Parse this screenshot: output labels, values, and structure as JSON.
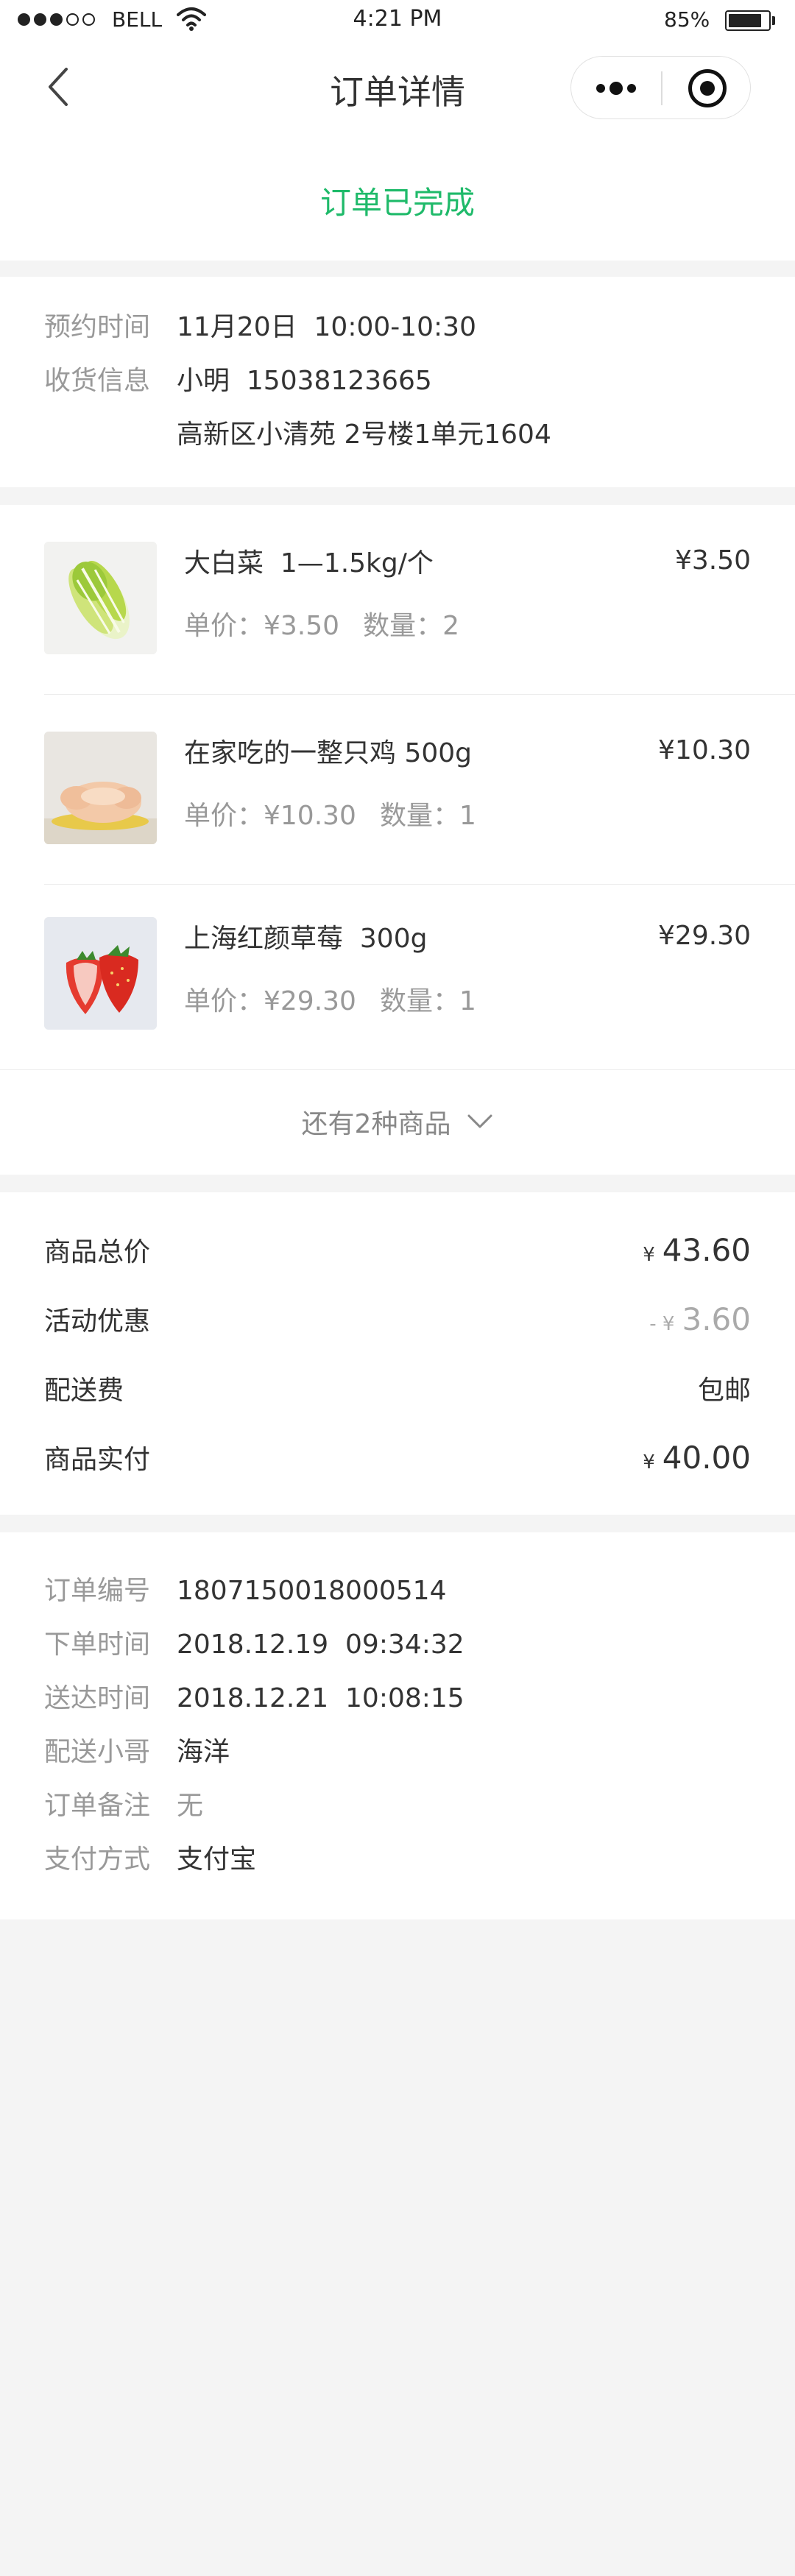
{
  "status_bar": {
    "carrier": "BELL",
    "time": "4:21 PM",
    "battery": "85%",
    "battery_level": 0.85
  },
  "navbar": {
    "title": "订单详情"
  },
  "order_status": "订单已完成",
  "booking": {
    "appointment_label": "预约时间",
    "appointment_value": "11月20日  10:00-10:30",
    "receiver_label": "收货信息",
    "receiver_name_phone": "小明  15038123665",
    "receiver_address": "高新区小清苑 2号楼1单元1604"
  },
  "products": [
    {
      "name": "大白菜  1—1.5kg/个",
      "unit_price": "单价：¥3.50",
      "quantity": "数量：2",
      "price": "¥3.50",
      "thumb_icon": "napa-cabbage-image"
    },
    {
      "name": "在家吃的一整只鸡 500g",
      "unit_price": "单价：¥10.30",
      "quantity": "数量：1",
      "price": "¥10.30",
      "thumb_icon": "whole-chicken-image"
    },
    {
      "name": "上海红颜草莓  300g",
      "unit_price": "单价：¥29.30",
      "quantity": "数量：1",
      "price": "¥29.30",
      "thumb_icon": "strawberry-image"
    }
  ],
  "more_goods": "还有2种商品",
  "summary": {
    "total_label": "商品总价",
    "total_symbol": "¥",
    "total_value": "43.60",
    "discount_label": "活动优惠",
    "discount_symbol": "- ¥",
    "discount_value": "3.60",
    "shipping_label": "配送费",
    "shipping_value": "包邮",
    "paid_label": "商品实付",
    "paid_symbol": "¥",
    "paid_value": "40.00"
  },
  "order_meta": [
    {
      "label": "订单编号",
      "value": "1807150018000514"
    },
    {
      "label": "下单时间",
      "value": "2018.12.19  09:34:32"
    },
    {
      "label": "送达时间",
      "value": "2018.12.21  10:08:15"
    },
    {
      "label": "配送小哥",
      "value": "海洋"
    },
    {
      "label": "订单备注",
      "value": "无"
    },
    {
      "label": "支付方式",
      "value": "支付宝"
    }
  ],
  "colors": {
    "accent_green": "#1fba6a",
    "page_bg": "#f4f4f4"
  }
}
